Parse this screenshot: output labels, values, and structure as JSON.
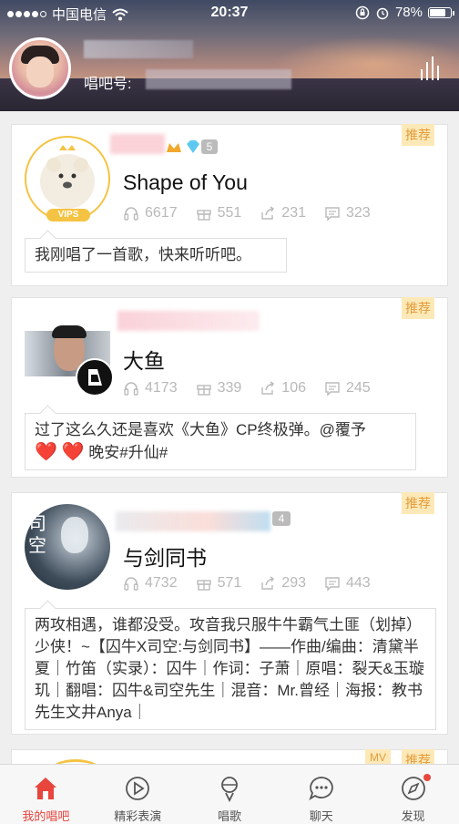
{
  "status_bar": {
    "carrier": "中国电信",
    "time": "20:37",
    "battery_percent": "78%",
    "battery_level": 0.78
  },
  "profile": {
    "id_label": "唱吧号:"
  },
  "feed": [
    {
      "badge": "推荐",
      "level": "5",
      "avatar_badge": "VIPS",
      "title": "Shape of You",
      "listens": "6617",
      "gifts": "551",
      "shares": "231",
      "comments": "323",
      "message": "我刚唱了一首歌，快来听听吧。"
    },
    {
      "badge": "推荐",
      "title": "大鱼",
      "listens": "4173",
      "gifts": "339",
      "shares": "106",
      "comments": "245",
      "message_line1": "过了这么久还是喜欢《大鱼》CP终极弹。@覆予",
      "message_line2": "晚安#升仙#"
    },
    {
      "badge": "推荐",
      "level": "4",
      "avatar_text_1": "司",
      "avatar_text_2": "空",
      "title": "与剑同书",
      "listens": "4732",
      "gifts": "571",
      "shares": "293",
      "comments": "443",
      "message": "两攻相遇，谁都没受。攻音我只服牛牛霸气土匪（划掉）少侠！~【囚牛X司空:与剑同书】——作曲/编曲：清黛半夏｜竹笛（实录）：囚牛｜作词：子萧｜原唱：裂天&玉璇玑｜翻唱：囚牛&司空先生｜混音：Mr.曾经｜海报：教书先生文井Anya｜"
    },
    {
      "mv_badge": "MV",
      "badge": "推荐"
    }
  ],
  "bottom_nav": [
    {
      "label": "我的唱吧",
      "icon": "home-icon",
      "active": true
    },
    {
      "label": "精彩表演",
      "icon": "play-icon",
      "active": false
    },
    {
      "label": "唱歌",
      "icon": "microphone-icon",
      "active": false
    },
    {
      "label": "聊天",
      "icon": "chat-icon",
      "active": false
    },
    {
      "label": "发现",
      "icon": "compass-icon",
      "active": false
    }
  ],
  "colors": {
    "accent": "#e8453c",
    "badge_bg": "#fde9b8",
    "badge_text": "#e49b3b",
    "stat_gray": "#b8b8b8"
  }
}
